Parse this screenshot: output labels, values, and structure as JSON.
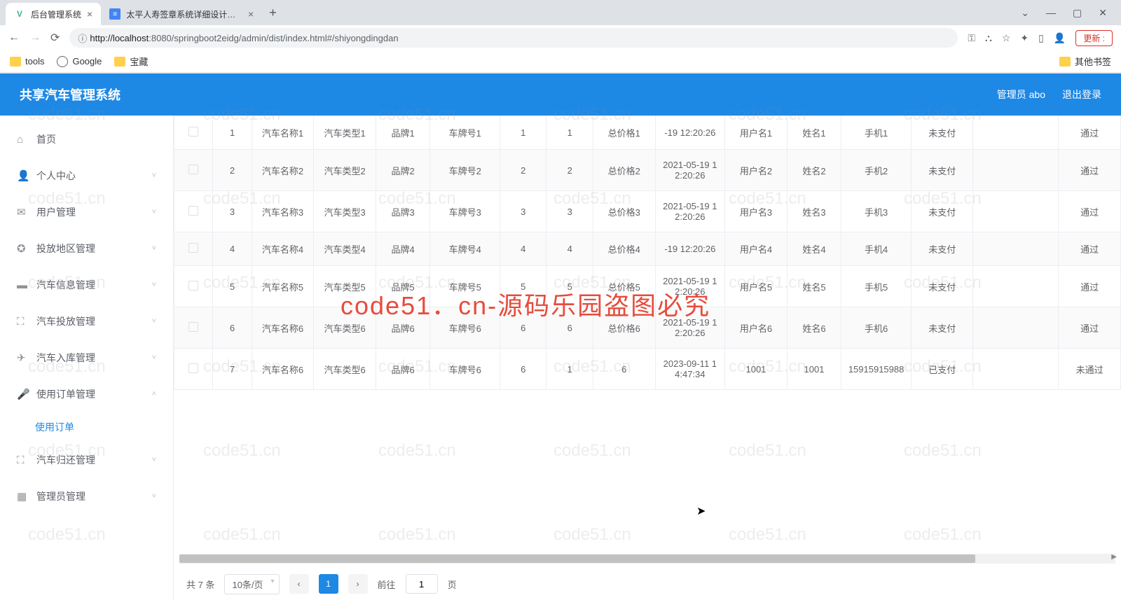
{
  "browser": {
    "tabs": [
      {
        "title": "后台管理系统",
        "icon": "V",
        "active": true
      },
      {
        "title": "太平人寿签章系统详细设计文档",
        "icon": "≡",
        "active": false
      }
    ],
    "url_proto": "ⓘ",
    "url_host": "http://localhost",
    "url_rest": ":8080/springboot2eidg/admin/dist/index.html#/shiyongdingdan",
    "update": "更新",
    "bookmarks": [
      {
        "label": "tools",
        "type": "folder"
      },
      {
        "label": "Google",
        "type": "globe"
      },
      {
        "label": "宝藏",
        "type": "folder"
      }
    ],
    "other_bookmarks": "其他书签"
  },
  "header": {
    "title": "共享汽车管理系统",
    "user_label": "管理员 abo",
    "logout": "退出登录"
  },
  "sidebar": [
    {
      "icon": "⌂",
      "label": "首页",
      "arrow": false
    },
    {
      "icon": "👤",
      "label": "个人中心",
      "arrow": true
    },
    {
      "icon": "✉",
      "label": "用户管理",
      "arrow": true
    },
    {
      "icon": "✪",
      "label": "投放地区管理",
      "arrow": true
    },
    {
      "icon": "▬",
      "label": "汽车信息管理",
      "arrow": true
    },
    {
      "icon": "⛶",
      "label": "汽车投放管理",
      "arrow": true
    },
    {
      "icon": "✈",
      "label": "汽车入库管理",
      "arrow": true
    },
    {
      "icon": "🎤",
      "label": "使用订单管理",
      "arrow": true,
      "expanded": true,
      "children": [
        "使用订单"
      ]
    },
    {
      "icon": "⛶",
      "label": "汽车归还管理",
      "arrow": true
    },
    {
      "icon": "▦",
      "label": "管理员管理",
      "arrow": true
    }
  ],
  "table": {
    "rows": [
      {
        "idx": "1",
        "name": "汽车名称1",
        "type": "汽车类型1",
        "brand": "品牌1",
        "plate": "车牌号1",
        "c1": "1",
        "c2": "1",
        "price": "总价格1",
        "time": "-19 12:20:26",
        "user": "用户名1",
        "uname": "姓名1",
        "phone": "手机1",
        "pay": "未支付",
        "status": "通过"
      },
      {
        "idx": "2",
        "name": "汽车名称2",
        "type": "汽车类型2",
        "brand": "品牌2",
        "plate": "车牌号2",
        "c1": "2",
        "c2": "2",
        "price": "总价格2",
        "time": "2021-05-19 12:20:26",
        "user": "用户名2",
        "uname": "姓名2",
        "phone": "手机2",
        "pay": "未支付",
        "status": "通过"
      },
      {
        "idx": "3",
        "name": "汽车名称3",
        "type": "汽车类型3",
        "brand": "品牌3",
        "plate": "车牌号3",
        "c1": "3",
        "c2": "3",
        "price": "总价格3",
        "time": "2021-05-19 12:20:26",
        "user": "用户名3",
        "uname": "姓名3",
        "phone": "手机3",
        "pay": "未支付",
        "status": "通过"
      },
      {
        "idx": "4",
        "name": "汽车名称4",
        "type": "汽车类型4",
        "brand": "品牌4",
        "plate": "车牌号4",
        "c1": "4",
        "c2": "4",
        "price": "总价格4",
        "time": "-19 12:20:26",
        "user": "用户名4",
        "uname": "姓名4",
        "phone": "手机4",
        "pay": "未支付",
        "status": "通过"
      },
      {
        "idx": "5",
        "name": "汽车名称5",
        "type": "汽车类型5",
        "brand": "品牌5",
        "plate": "车牌号5",
        "c1": "5",
        "c2": "5",
        "price": "总价格5",
        "time": "2021-05-19 12:20:26",
        "user": "用户名5",
        "uname": "姓名5",
        "phone": "手机5",
        "pay": "未支付",
        "status": "通过"
      },
      {
        "idx": "6",
        "name": "汽车名称6",
        "type": "汽车类型6",
        "brand": "品牌6",
        "plate": "车牌号6",
        "c1": "6",
        "c2": "6",
        "price": "总价格6",
        "time": "2021-05-19 12:20:26",
        "user": "用户名6",
        "uname": "姓名6",
        "phone": "手机6",
        "pay": "未支付",
        "status": "通过"
      },
      {
        "idx": "7",
        "name": "汽车名称6",
        "type": "汽车类型6",
        "brand": "品牌6",
        "plate": "车牌号6",
        "c1": "6",
        "c2": "1",
        "price": "6",
        "time": "2023-09-11 14:47:34",
        "user": "1001",
        "uname": "1001",
        "phone": "15915915988",
        "pay": "已支付",
        "status": "未通过"
      }
    ]
  },
  "pager": {
    "total": "共 7 条",
    "page_size": "10条/页",
    "page": "1",
    "jump_prefix": "前往",
    "jump_value": "1",
    "jump_suffix": "页"
  },
  "watermark_small": "code51.cn",
  "watermark_big": "code51．cn-源码乐园盗图必究"
}
